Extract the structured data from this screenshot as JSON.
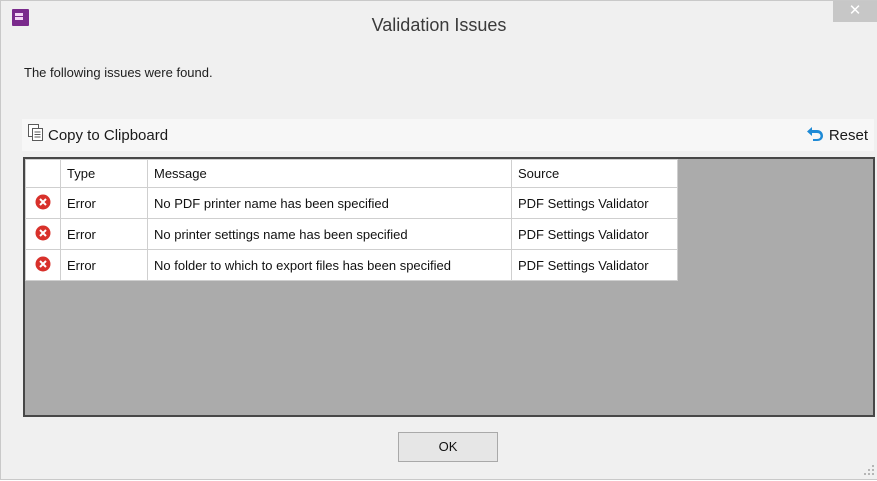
{
  "window": {
    "title": "Validation Issues",
    "close_symbol": "✕",
    "app_icon": "powerpoint-app-icon"
  },
  "intro_text": "The following issues were found.",
  "toolbar": {
    "copy_label": "Copy to Clipboard",
    "copy_icon": "copy-icon",
    "reset_label": "Reset",
    "reset_icon": "reset-icon"
  },
  "grid": {
    "columns": [
      "",
      "Type",
      "Message",
      "Source"
    ],
    "rows": [
      {
        "icon": "error-icon",
        "type": "Error",
        "message": "No PDF printer name has been specified",
        "source": "PDF Settings Validator"
      },
      {
        "icon": "error-icon",
        "type": "Error",
        "message": "No printer settings name has been specified",
        "source": "PDF Settings Validator"
      },
      {
        "icon": "error-icon",
        "type": "Error",
        "message": "No folder to which to export files has been specified",
        "source": "PDF Settings Validator"
      }
    ]
  },
  "buttons": {
    "ok_label": "OK"
  },
  "colors": {
    "error_red": "#d8312b",
    "reset_blue": "#1e8ad6",
    "grid_background": "#ababab",
    "dialog_background": "#f0f0f0"
  }
}
